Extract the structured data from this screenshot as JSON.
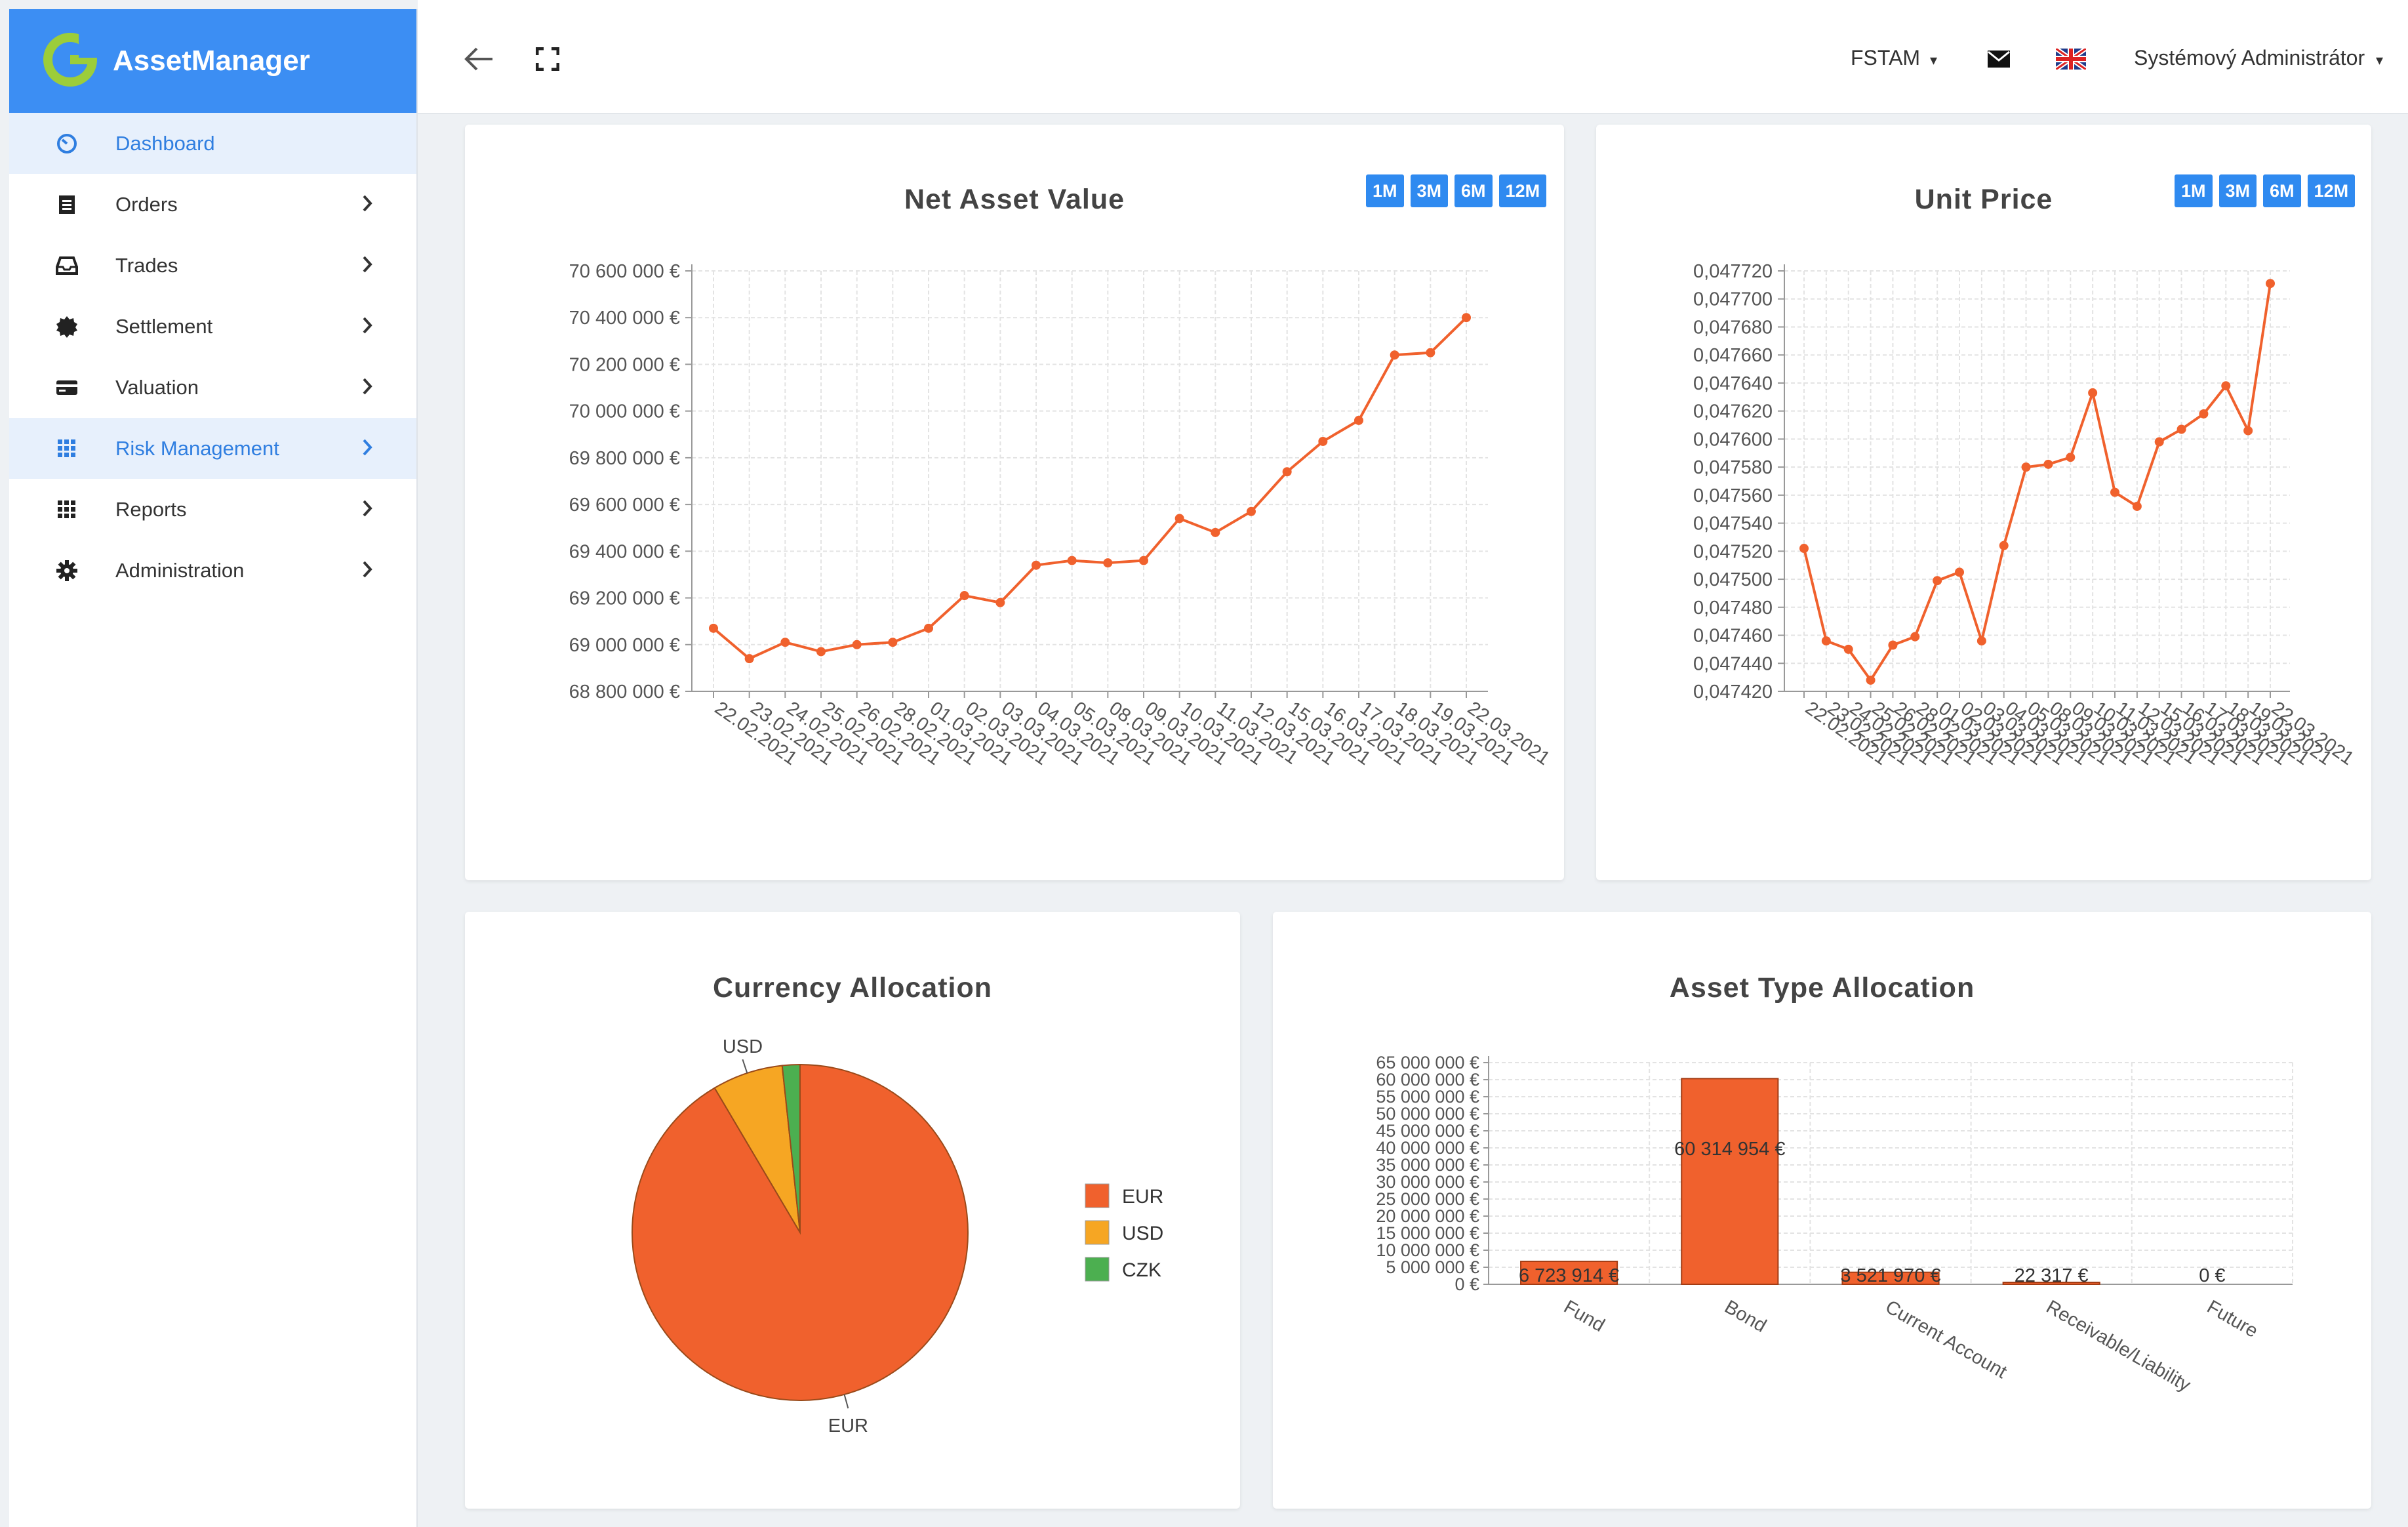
{
  "app": {
    "name": "AssetManager"
  },
  "sidebar": {
    "items": [
      {
        "label": "Dashboard",
        "active": true
      },
      {
        "label": "Orders"
      },
      {
        "label": "Trades"
      },
      {
        "label": "Settlement"
      },
      {
        "label": "Valuation"
      },
      {
        "label": "Risk Management",
        "highlighted": true
      },
      {
        "label": "Reports"
      },
      {
        "label": "Administration"
      }
    ]
  },
  "topbar": {
    "company": "FSTAM",
    "user": "Systémový Administrátor",
    "language_icon": "uk-flag-icon"
  },
  "colors": {
    "accent": "#3c8ef3",
    "series": "#f0612d",
    "usd": "#f6a623",
    "czk": "#4caf50"
  },
  "range_buttons": [
    "1M",
    "3M",
    "6M",
    "12M"
  ],
  "charts": {
    "nav": {
      "title": "Net Asset Value",
      "chart_data": {
        "type": "line",
        "title": "Net Asset Value",
        "x": [
          "22.02.2021",
          "23.02.2021",
          "24.02.2021",
          "25.02.2021",
          "26.02.2021",
          "28.02.2021",
          "01.03.2021",
          "02.03.2021",
          "03.03.2021",
          "04.03.2021",
          "05.03.2021",
          "08.03.2021",
          "09.03.2021",
          "10.03.2021",
          "11.03.2021",
          "12.03.2021",
          "15.03.2021",
          "16.03.2021",
          "17.03.2021",
          "18.03.2021",
          "19.03.2021",
          "22.03.2021"
        ],
        "values": [
          69070000,
          68940000,
          69010000,
          68970000,
          69000000,
          69010000,
          69070000,
          69210000,
          69180000,
          69340000,
          69360000,
          69350000,
          69360000,
          69540000,
          69480000,
          69570000,
          69740000,
          69870000,
          69960000,
          70240000,
          70250000,
          70400000
        ],
        "ylim": [
          68800000,
          70600000
        ],
        "yticks": [
          "68 800 000 €",
          "69 000 000 €",
          "69 200 000 €",
          "69 400 000 €",
          "69 600 000 €",
          "69 800 000 €",
          "70 000 000 €",
          "70 200 000 €",
          "70 400 000 €",
          "70 600 000 €"
        ],
        "grid": true
      }
    },
    "unit": {
      "title": "Unit Price",
      "chart_data": {
        "type": "line",
        "title": "Unit Price",
        "x": [
          "22.02.2021",
          "23.02.2021",
          "24.02.2021",
          "25.02.2021",
          "26.02.2021",
          "28.02.2021",
          "01.03.2021",
          "02.03.2021",
          "03.03.2021",
          "04.03.2021",
          "05.03.2021",
          "08.03.2021",
          "09.03.2021",
          "10.03.2021",
          "11.03.2021",
          "12.03.2021",
          "15.03.2021",
          "16.03.2021",
          "17.03.2021",
          "18.03.2021",
          "19.03.2021",
          "22.03.2021"
        ],
        "values": [
          0.047522,
          0.047456,
          0.04745,
          0.047428,
          0.047453,
          0.047459,
          0.047499,
          0.047505,
          0.047456,
          0.047524,
          0.04758,
          0.047582,
          0.047587,
          0.047633,
          0.047562,
          0.047552,
          0.047598,
          0.047607,
          0.047618,
          0.047638,
          0.047606,
          0.047711
        ],
        "ylim": [
          0.04742,
          0.04772
        ],
        "yticks": [
          "0,047420",
          "0,047440",
          "0,047460",
          "0,047480",
          "0,047500",
          "0,047520",
          "0,047540",
          "0,047560",
          "0,047580",
          "0,047600",
          "0,047620",
          "0,047640",
          "0,047660",
          "0,047680",
          "0,047700",
          "0,047720"
        ],
        "grid": true
      }
    },
    "currency": {
      "title": "Currency Allocation",
      "chart_data": {
        "type": "pie",
        "title": "Currency Allocation",
        "labels": [
          "EUR",
          "USD",
          "CZK"
        ],
        "values": [
          91.5,
          6.8,
          1.7
        ],
        "legend": "right"
      }
    },
    "asset": {
      "title": "Asset Type Allocation",
      "chart_data": {
        "type": "bar",
        "title": "Asset Type Allocation",
        "categories": [
          "Fund",
          "Bond",
          "Current Account",
          "Receivable/Liability",
          "Future"
        ],
        "values": [
          6723914,
          60314954,
          3521970,
          22317,
          0
        ],
        "value_labels": [
          "6 723 914 €",
          "60 314 954 €",
          "3 521 970 €",
          "22 317 €",
          "0 €"
        ],
        "ylim": [
          0,
          65000000
        ],
        "yticks": [
          "0 €",
          "5 000 000 €",
          "10 000 000 €",
          "15 000 000 €",
          "20 000 000 €",
          "25 000 000 €",
          "30 000 000 €",
          "35 000 000 €",
          "40 000 000 €",
          "45 000 000 €",
          "50 000 000 €",
          "55 000 000 €",
          "60 000 000 €",
          "65 000 000 €"
        ],
        "grid": true
      }
    }
  }
}
